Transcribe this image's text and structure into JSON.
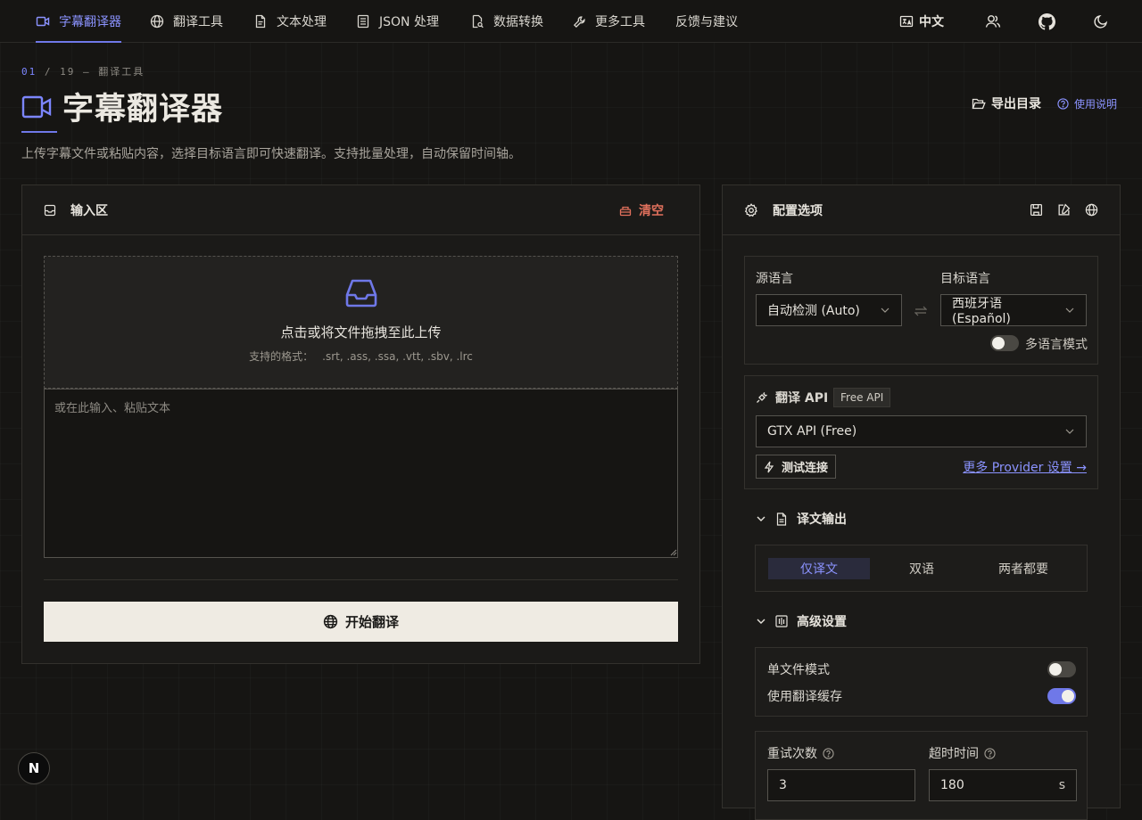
{
  "nav": {
    "items": [
      {
        "label": "字幕翻译器",
        "icon": "video-icon"
      },
      {
        "label": "翻译工具",
        "icon": "globe-icon"
      },
      {
        "label": "文本处理",
        "icon": "document-icon"
      },
      {
        "label": "JSON 处理",
        "icon": "braces-file-icon"
      },
      {
        "label": "数据转换",
        "icon": "file-search-icon"
      },
      {
        "label": "更多工具",
        "icon": "wrench-icon"
      },
      {
        "label": "反馈与建议",
        "icon": ""
      }
    ],
    "active_index": 0,
    "language_label": "中文",
    "right_icons": [
      "language-icon",
      "users-icon",
      "github-icon",
      "moon-icon"
    ]
  },
  "header": {
    "breadcrumb_index": "01",
    "breadcrumb_rest": " / 19 — 翻译工具",
    "title": "字幕翻译器",
    "subtitle": "上传字幕文件或粘贴内容，选择目标语言即可快速翻译。支持批量处理，自动保留时间轴。",
    "export_label": "导出目录",
    "help_label": "使用说明"
  },
  "input_panel": {
    "title": "输入区",
    "clear_label": "清空",
    "dropzone_title": "点击或将文件拖拽至此上传",
    "formats_label": "支持的格式：",
    "formats": ".srt, .ass, .ssa, .vtt, .sbv, .lrc",
    "textarea_placeholder": "或在此输入、粘贴文本",
    "textarea_value": "",
    "start_label": "开始翻译"
  },
  "config_panel": {
    "title": "配置选项",
    "languages": {
      "source_label": "源语言",
      "source_value": "自动检测 (Auto)",
      "target_label": "目标语言",
      "target_value": "西班牙语 (Español)",
      "multi_lang_label": "多语言模式",
      "multi_lang_on": false
    },
    "api": {
      "label": "翻译 API",
      "badge": "Free API",
      "provider_value": "GTX API (Free)",
      "test_label": "测试连接",
      "more_link": "更多 Provider 设置 →"
    },
    "output": {
      "section_label": "译文输出",
      "options": [
        "仅译文",
        "双语",
        "两者都要"
      ],
      "selected_index": 0
    },
    "advanced": {
      "section_label": "高级设置",
      "single_file_label": "单文件模式",
      "single_file_on": false,
      "cache_label": "使用翻译缓存",
      "cache_on": true,
      "retry_label": "重试次数",
      "retry_value": "3",
      "timeout_label": "超时时间",
      "timeout_value": "180",
      "timeout_unit": "s"
    }
  },
  "badge_letter": "N",
  "colors": {
    "background": "#161513",
    "panel": "#1b1a18",
    "accent": "#6f78e8",
    "danger": "#e0705c",
    "primary_button": "#efebe3"
  }
}
